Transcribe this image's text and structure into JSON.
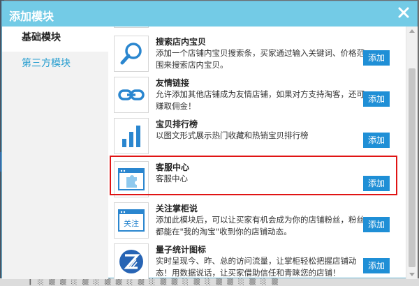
{
  "dialog": {
    "title": "添加模块",
    "close_label": "×"
  },
  "sidebar": {
    "items": [
      {
        "label": "基础模块",
        "active": true
      },
      {
        "label": "第三方模块",
        "active": false
      }
    ]
  },
  "modules": [
    {
      "name": "搜索店内宝贝",
      "desc": "添加一个店铺内宝贝搜索条，买家通过输入关键词、价格范围来搜索店内宝贝。",
      "icon": "search-icon",
      "add_label": "添加"
    },
    {
      "name": "友情链接",
      "desc": "允许添加其他店铺成为友情店铺，如果对方支持淘客，还可赚取佣金！",
      "icon": "link-icon",
      "add_label": "添加"
    },
    {
      "name": "宝贝排行榜",
      "desc": "以图文形式展示热门收藏和热销宝贝排行榜",
      "icon": "bar-chart-icon",
      "add_label": "添加"
    },
    {
      "name": "客服中心",
      "desc": "客服中心",
      "icon": "puzzle-window-icon",
      "add_label": "添加"
    },
    {
      "name": "关注掌柜说",
      "desc": "添加此模块后，可以让买家有机会成为你的店铺粉丝，粉丝都能在\"我的淘宝\"收到你的店铺动态。",
      "icon": "follow-window-icon",
      "icon_text": "关注",
      "add_label": "添加"
    },
    {
      "name": "量子统计图标",
      "desc": "实时呈现今、昨、总的访问流量，让掌柜轻松把握店铺动态！用数据说话，让买家借助信任和青睐您的店铺！",
      "icon": "quantum-stats-icon",
      "add_label": "添加"
    }
  ],
  "colors": {
    "titlebar": "#73cbe6",
    "accent": "#1f8fd6",
    "link": "#2a9fd0",
    "highlight": "#e01414"
  }
}
